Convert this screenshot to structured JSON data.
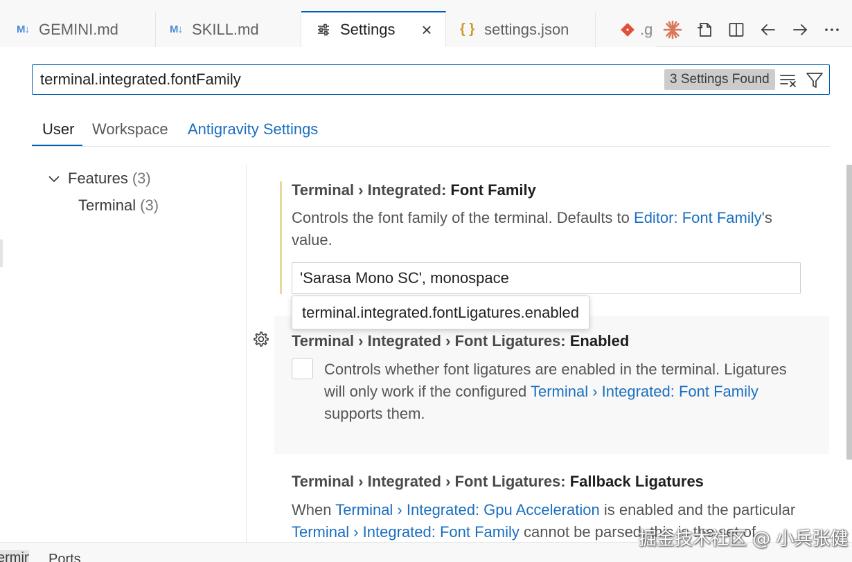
{
  "tabs": [
    {
      "label": "GEMINI.md",
      "icon": "markdown-icon",
      "icon_text": "M↓"
    },
    {
      "label": "SKILL.md",
      "icon": "markdown-icon",
      "icon_text": "M↓"
    },
    {
      "label": "Settings",
      "icon": "settings-sliders-icon",
      "active": true
    },
    {
      "label": "settings.json",
      "icon": "json-braces-icon",
      "icon_text": "{ }"
    },
    {
      "label": ".g",
      "icon": "git-icon"
    }
  ],
  "search": {
    "value": "terminal.integrated.fontFamily",
    "count_label": "3 Settings Found"
  },
  "scopes": {
    "user": "User",
    "workspace": "Workspace",
    "antigravity": "Antigravity Settings"
  },
  "toc": {
    "features_label": "Features",
    "features_count": "(3)",
    "terminal_label": "Terminal",
    "terminal_count": "(3)"
  },
  "settings": {
    "font_family": {
      "category": "Terminal › Integrated: ",
      "name": "Font Family",
      "desc_before": "Controls the font family of the terminal. Defaults to ",
      "desc_link": "Editor: Font Family",
      "desc_after": "'s",
      "desc_line2": "value.",
      "value": "'Sarasa Mono SC', monospace"
    },
    "tooltip": "terminal.integrated.fontLigatures.enabled",
    "ligatures_enabled": {
      "category": "Terminal › Integrated › Font Ligatures: ",
      "name": "Enabled",
      "desc_line1": "Controls whether font ligatures are enabled in the terminal. Ligatures",
      "desc_line2_before": "will only work if the configured ",
      "desc_line2_link": "Terminal › Integrated: Font Family",
      "desc_line3": "supports them.",
      "checked": false
    },
    "fallback_ligatures": {
      "category": "Terminal › Integrated › Font Ligatures: ",
      "name": "Fallback Ligatures",
      "desc_line1_before": "When ",
      "desc_line1_link": "Terminal › Integrated: Gpu Acceleration",
      "desc_line1_after": " is enabled and the particular",
      "desc_line2_link": "Terminal › Integrated: Font Family",
      "desc_line2_after": " cannot be parsed, this is the set of"
    }
  },
  "panel": {
    "active_tab": "Terminal",
    "ports_tab": "Ports"
  },
  "watermark": "掘金技术社区 @ 小兵张健",
  "colors": {
    "accent": "#005fb8",
    "link": "#1a6fbf",
    "modified": "#e9d89c"
  }
}
